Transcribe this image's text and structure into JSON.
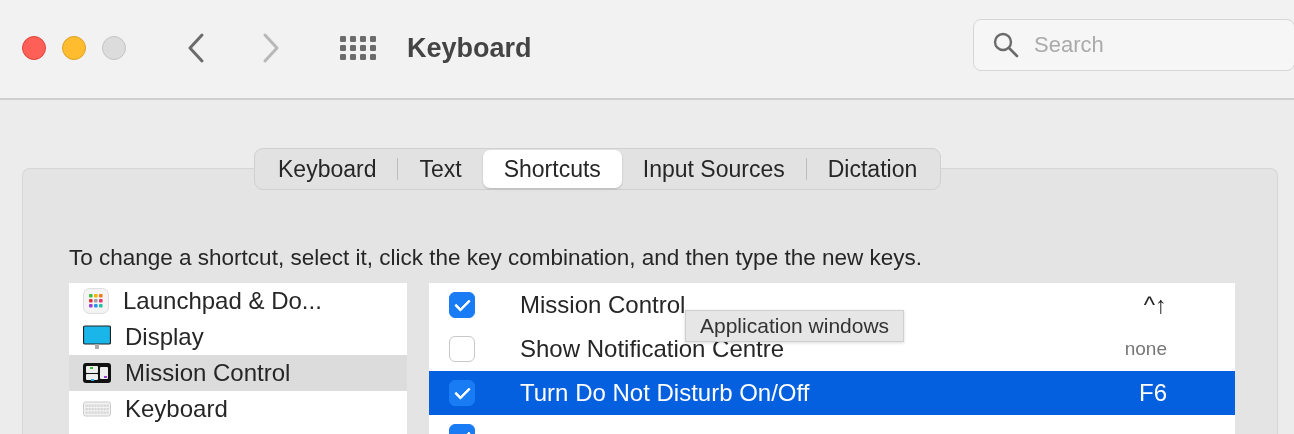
{
  "window": {
    "title": "Keyboard"
  },
  "search": {
    "placeholder": "Search"
  },
  "tabs": [
    {
      "label": "Keyboard",
      "selected": false
    },
    {
      "label": "Text",
      "selected": false
    },
    {
      "label": "Shortcuts",
      "selected": true
    },
    {
      "label": "Input Sources",
      "selected": false
    },
    {
      "label": "Dictation",
      "selected": false
    }
  ],
  "instruction": "To change a shortcut, select it, click the key combination, and then type the new keys.",
  "categories": [
    {
      "label": "Launchpad & Do...",
      "kind": "launchpad",
      "selected": false
    },
    {
      "label": "Display",
      "kind": "display",
      "selected": false
    },
    {
      "label": "Mission Control",
      "kind": "mission",
      "selected": true
    },
    {
      "label": "Keyboard",
      "kind": "keyboard",
      "selected": false
    }
  ],
  "shortcuts": [
    {
      "label": "Mission Control",
      "checked": true,
      "selected": false,
      "keys": "^↑",
      "kind": "set"
    },
    {
      "label": "Show Notification Centre",
      "checked": false,
      "selected": false,
      "keys": "none",
      "kind": "none"
    },
    {
      "label": "Turn Do Not Disturb On/Off",
      "checked": true,
      "selected": true,
      "keys": "F6",
      "kind": "set"
    },
    {
      "checked": true,
      "selected": false
    }
  ],
  "tooltip": "Application windows"
}
